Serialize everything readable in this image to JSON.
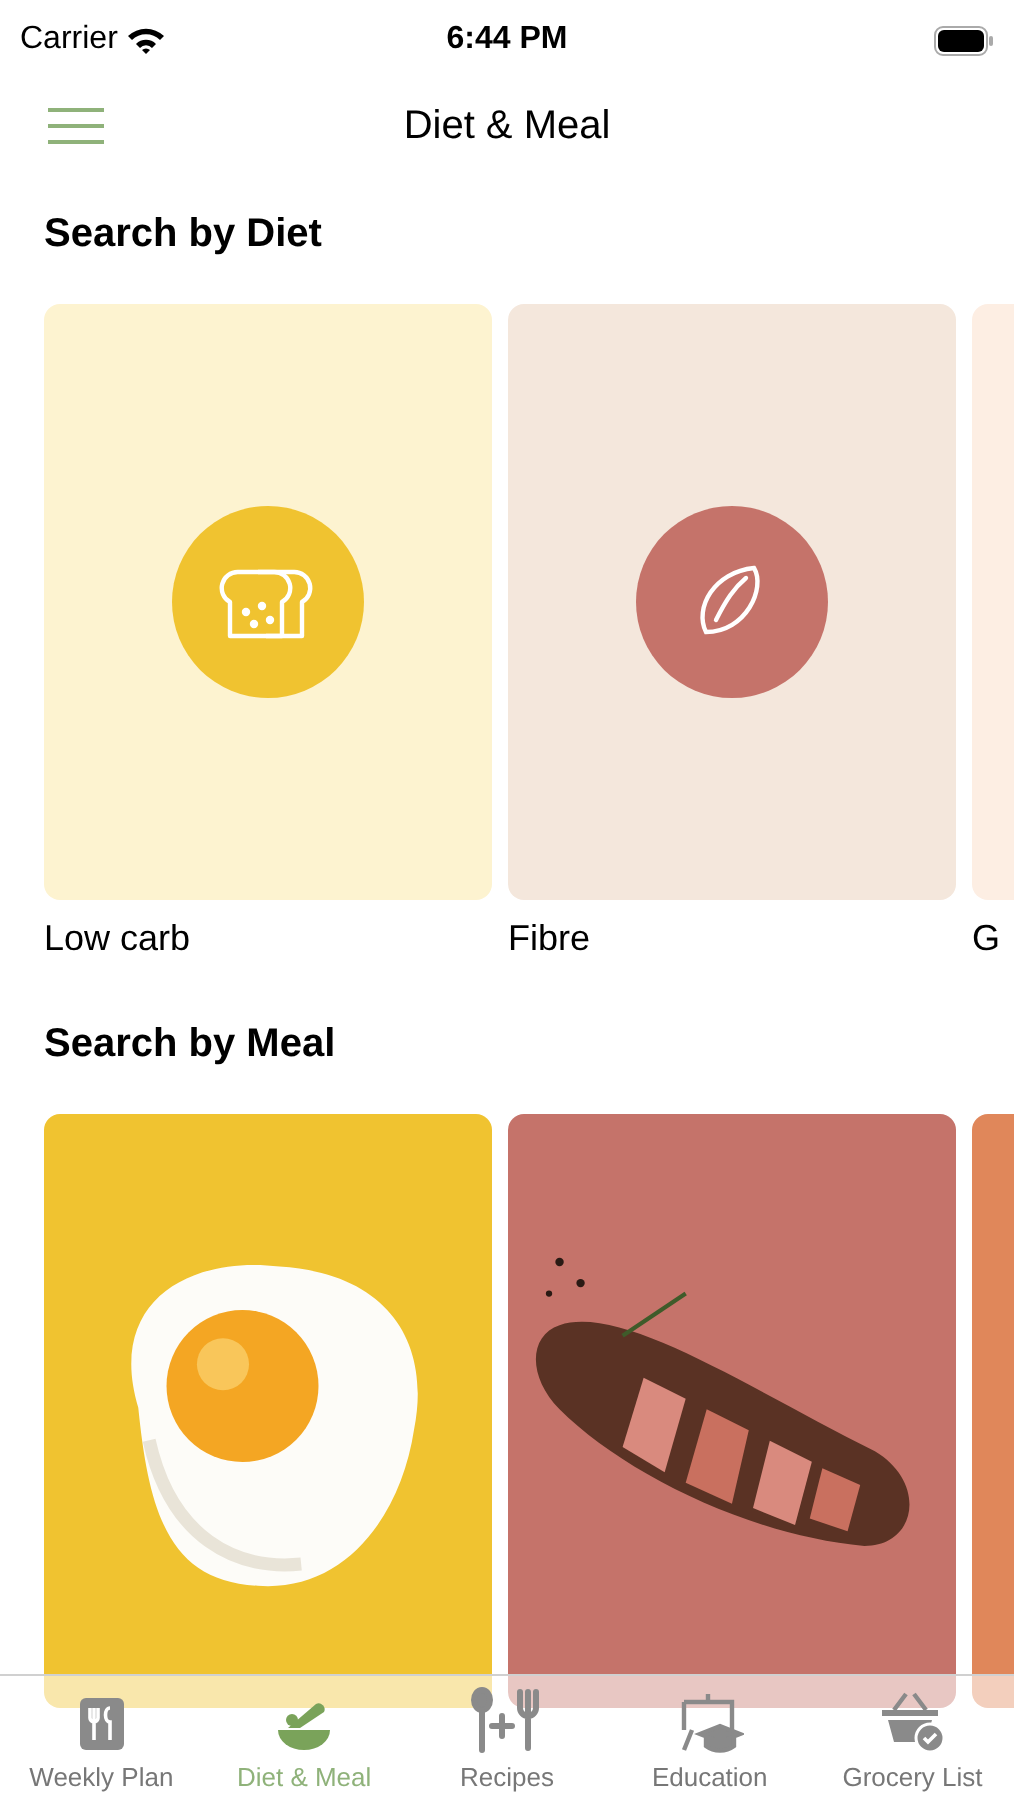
{
  "status_bar": {
    "carrier": "Carrier",
    "time": "6:44 PM"
  },
  "header": {
    "title": "Diet & Meal"
  },
  "diet_section": {
    "title": "Search by Diet",
    "items": [
      {
        "label": "Low carb",
        "color": "#fdf3d0"
      },
      {
        "label": "Fibre",
        "color": "#f4e7dc"
      },
      {
        "label": "G",
        "color": "#fdeee3"
      }
    ]
  },
  "meal_section": {
    "title": "Search by Meal",
    "items": [
      {
        "color": "#f0c330"
      },
      {
        "color": "#c5736a"
      },
      {
        "color": "#e0875a"
      }
    ]
  },
  "tab_bar": [
    {
      "label": "Weekly Plan",
      "selected": false
    },
    {
      "label": "Diet & Meal",
      "selected": true
    },
    {
      "label": "Recipes",
      "selected": false
    },
    {
      "label": "Education",
      "selected": false
    },
    {
      "label": "Grocery List",
      "selected": false
    }
  ]
}
